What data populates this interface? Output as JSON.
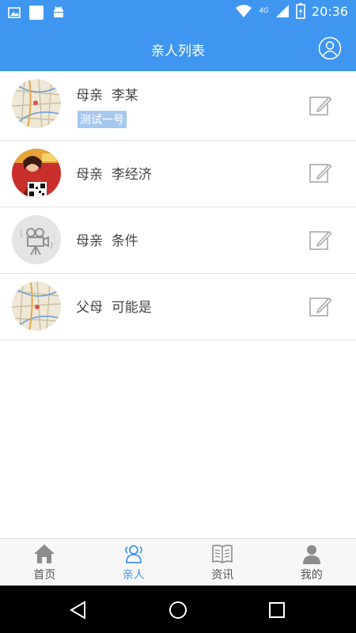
{
  "status_bar": {
    "time": "20:36",
    "network": "4G",
    "icons": [
      "image-icon",
      "app-icon",
      "android-icon",
      "wifi-icon",
      "signal-icon",
      "battery-icon"
    ]
  },
  "header": {
    "title": "亲人列表",
    "profile_icon": "user-circle-icon"
  },
  "contacts": [
    {
      "relation": "母亲",
      "name": "李某",
      "tag": "测试一号",
      "avatar": "map-avatar"
    },
    {
      "relation": "母亲",
      "name": "李经济",
      "tag": "",
      "avatar": "promo-qr-avatar"
    },
    {
      "relation": "母亲",
      "name": "条件",
      "tag": "",
      "avatar": "camera-avatar"
    },
    {
      "relation": "父母",
      "name": "可能是",
      "tag": "",
      "avatar": "map-avatar"
    }
  ],
  "tabs": [
    {
      "label": "首页",
      "icon": "home-icon",
      "active": false
    },
    {
      "label": "亲人",
      "icon": "people-icon",
      "active": true
    },
    {
      "label": "资讯",
      "icon": "book-icon",
      "active": false
    },
    {
      "label": "我的",
      "icon": "person-icon",
      "active": false
    }
  ],
  "colors": {
    "primary": "#3f96f0",
    "tag_bg": "#a6c8ef",
    "divider": "#e3e3e3",
    "tab_bar_bg": "#f7f7f7"
  }
}
